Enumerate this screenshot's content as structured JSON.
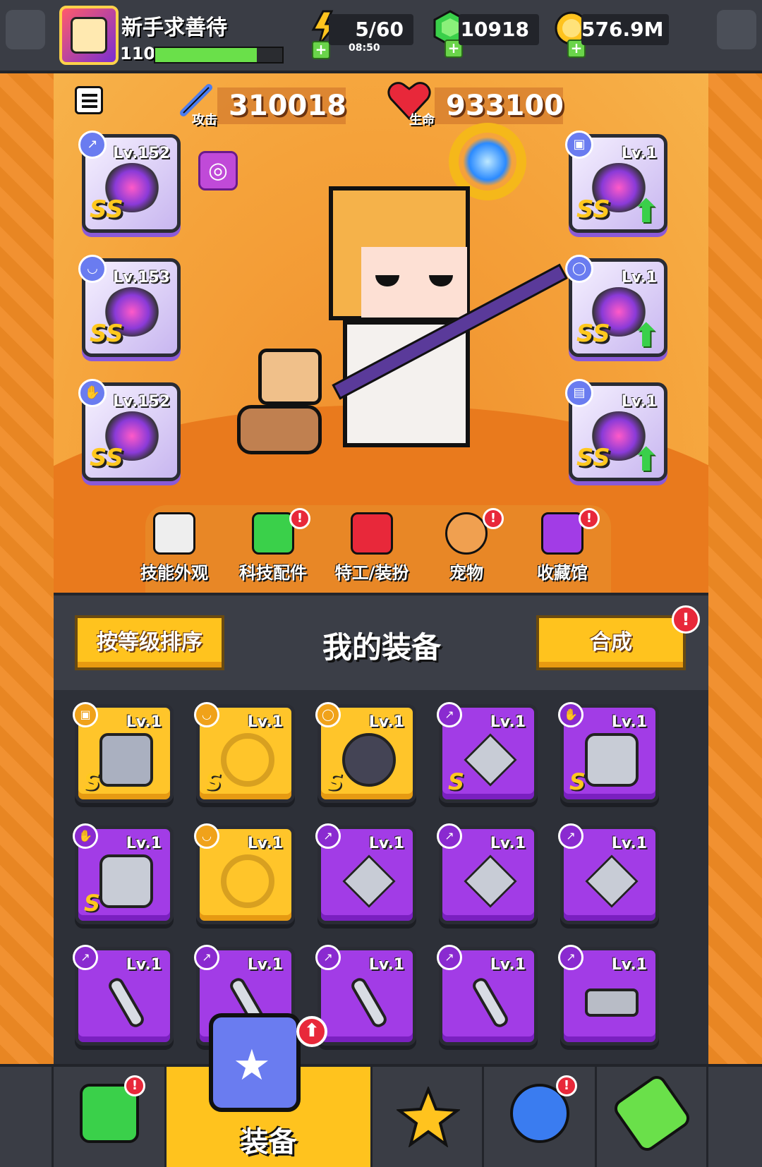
{
  "player": {
    "name": "新手求善待",
    "level": "110",
    "xp_fraction": 0.8
  },
  "resources": {
    "energy": "5/60",
    "energy_timer": "08:50",
    "gems": "10918",
    "gold": "576.9M"
  },
  "stats": {
    "attack_label": "攻击",
    "attack_value": "310018",
    "hp_label": "生命",
    "hp_value": "933100"
  },
  "equipped_left": [
    {
      "level": "Lv.152",
      "grade": "SS",
      "icon": "weapon-icon"
    },
    {
      "level": "Lv.153",
      "grade": "SS",
      "icon": "necklace-icon"
    },
    {
      "level": "Lv.152",
      "grade": "SS",
      "icon": "glove-icon"
    }
  ],
  "equipped_right": [
    {
      "level": "Lv.1",
      "grade": "SS",
      "icon": "armor-icon",
      "upgrade": true
    },
    {
      "level": "Lv.1",
      "grade": "SS",
      "icon": "belt-icon",
      "upgrade": true
    },
    {
      "level": "Lv.1",
      "grade": "SS",
      "icon": "boots-icon",
      "upgrade": true
    }
  ],
  "nav_tabs": [
    {
      "label": "技能外观",
      "alert": false
    },
    {
      "label": "科技配件",
      "alert": true
    },
    {
      "label": "特工/装扮",
      "alert": false
    },
    {
      "label": "宠物",
      "alert": true
    },
    {
      "label": "收藏馆",
      "alert": true
    }
  ],
  "equipment_panel": {
    "sort_button": "按等级排序",
    "title": "我的装备",
    "merge_button": "合成",
    "merge_alert": "!"
  },
  "inventory": [
    {
      "level": "Lv.1",
      "grade": "S",
      "rarity": "gold",
      "icon": "armor-icon"
    },
    {
      "level": "Lv.1",
      "grade": "S",
      "rarity": "gold",
      "icon": "necklace-icon"
    },
    {
      "level": "Lv.1",
      "grade": "S",
      "rarity": "gold",
      "icon": "belt-icon"
    },
    {
      "level": "Lv.1",
      "grade": "S",
      "rarity": "purple",
      "icon": "kunai-icon"
    },
    {
      "level": "Lv.1",
      "grade": "S",
      "rarity": "purple",
      "icon": "glove-icon"
    },
    {
      "level": "Lv.1",
      "grade": "S",
      "rarity": "purple",
      "icon": "glove-icon"
    },
    {
      "level": "Lv.1",
      "grade": "",
      "rarity": "gold",
      "icon": "necklace-icon"
    },
    {
      "level": "Lv.1",
      "grade": "",
      "rarity": "purple",
      "icon": "kunai-icon"
    },
    {
      "level": "Lv.1",
      "grade": "",
      "rarity": "purple",
      "icon": "kunai-icon"
    },
    {
      "level": "Lv.1",
      "grade": "",
      "rarity": "purple",
      "icon": "kunai-icon"
    },
    {
      "level": "Lv.1",
      "grade": "",
      "rarity": "purple",
      "icon": "sword-icon"
    },
    {
      "level": "Lv.1",
      "grade": "",
      "rarity": "purple",
      "icon": "sword-icon"
    },
    {
      "level": "Lv.1",
      "grade": "",
      "rarity": "purple",
      "icon": "sword-icon"
    },
    {
      "level": "Lv.1",
      "grade": "",
      "rarity": "purple",
      "icon": "sword-icon"
    },
    {
      "level": "Lv.1",
      "grade": "",
      "rarity": "purple",
      "icon": "revolver-icon"
    }
  ],
  "bottom_nav": {
    "equip_label": "装备"
  },
  "colors": {
    "gold_rarity": "#ffc52a",
    "purple_rarity": "#a23ce6",
    "accent_yellow": "#ffc31e",
    "alert_red": "#e8283a"
  }
}
